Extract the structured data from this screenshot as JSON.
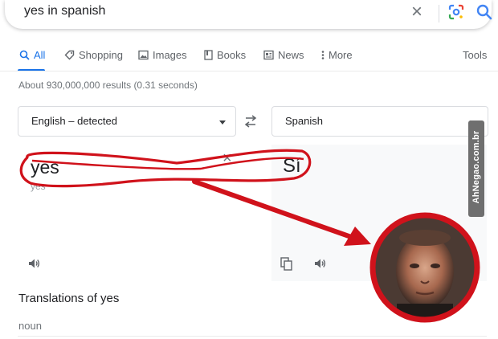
{
  "search": {
    "query": "yes in spanish"
  },
  "tabs": [
    {
      "label": "All"
    },
    {
      "label": "Shopping"
    },
    {
      "label": "Images"
    },
    {
      "label": "Books"
    },
    {
      "label": "News"
    },
    {
      "label": "More"
    },
    {
      "label": "Tools"
    }
  ],
  "stats": "About 930,000,000 results (0.31 seconds)",
  "translator": {
    "source_lang": "English – detected",
    "target_lang": "Spanish",
    "source_text": "yes",
    "pronunciation": "yes",
    "target_text": "Sí"
  },
  "translations_heading": "Translations of yes",
  "part_of_speech": "noun",
  "watermark": "AhNegao.com.br",
  "colors": {
    "accent": "#1a73e8",
    "highlight": "#d0121b"
  },
  "icons": [
    "search-icon",
    "clear-icon",
    "lens-icon",
    "swap-icon",
    "speaker-icon",
    "copy-icon"
  ]
}
